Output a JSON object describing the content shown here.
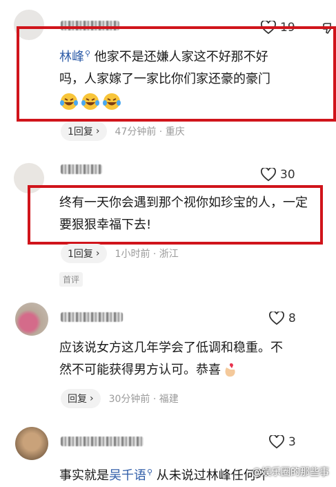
{
  "comments": [
    {
      "likes": "19",
      "mention": "林峰",
      "text": "他家不是还嫌人家这不好那不好吗，人家嫁了一家比你们家还豪的豪门",
      "reply_label": "1回复",
      "meta": "47分钟前 · 重庆"
    },
    {
      "likes": "30",
      "text": "终有一天你会遇到那个视你如珍宝的人，一定要狠狠幸福下去!",
      "reply_label": "1回复",
      "meta": "1小时前 · 浙江",
      "tag": "首评"
    },
    {
      "likes": "8",
      "text": "应该说女方这几年学会了低调和稳重。不然不可能获得男方认可。恭喜",
      "reply_label": "回复",
      "meta": "30分钟前 · 福建"
    },
    {
      "likes": "3",
      "text_prefix": "事实就是",
      "mention": "吴千语",
      "text": "从未说过林峰任何坏"
    }
  ],
  "watermark": "@娱乐圈的那些事",
  "colors": {
    "highlight_box": "#d0141b",
    "mention": "#2f5da8"
  }
}
